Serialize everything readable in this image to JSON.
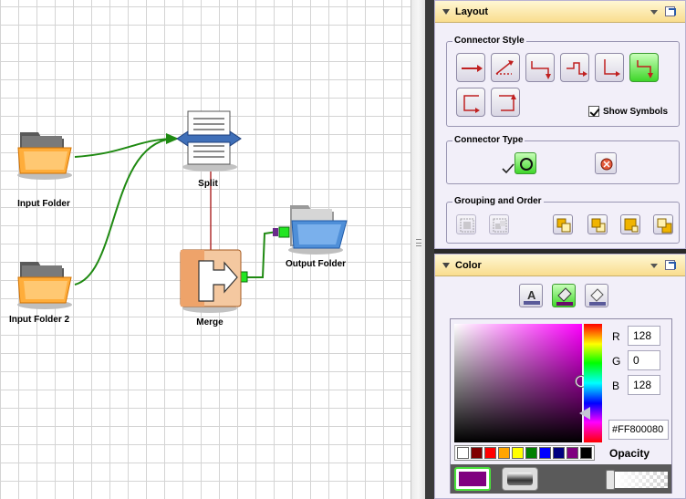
{
  "canvas": {
    "nodes": {
      "input_folder_1": {
        "label": "Input Folder"
      },
      "input_folder_2": {
        "label": "Input Folder 2"
      },
      "split": {
        "label": "Split"
      },
      "merge": {
        "label": "Merge"
      },
      "output_folder": {
        "label": "Output Folder"
      }
    }
  },
  "layout_panel": {
    "title": "Layout",
    "connector_style": {
      "title": "Connector Style",
      "buttons": [
        {
          "icon": "straight-connector-icon",
          "active": false
        },
        {
          "icon": "spline-connector-icon",
          "active": false
        },
        {
          "icon": "orthogonal-connector-icon",
          "active": false
        },
        {
          "icon": "ortho-step-connector-icon",
          "active": false
        },
        {
          "icon": "ortho-corner-connector-icon",
          "active": false
        },
        {
          "icon": "ortho-zigzag-connector-icon",
          "active": true
        },
        {
          "icon": "loop-left-connector-icon",
          "active": false
        },
        {
          "icon": "loop-right-connector-icon",
          "active": false
        }
      ],
      "show_symbols_label": "Show Symbols",
      "show_symbols_checked": true
    },
    "connector_type": {
      "title": "Connector Type",
      "options": [
        {
          "icon": "circle-connector-icon",
          "selected": true
        },
        {
          "icon": "cross-connector-icon",
          "selected": false
        }
      ]
    },
    "grouping_order": {
      "title": "Grouping and Order",
      "buttons": [
        "group-icon",
        "ungroup-icon",
        "bring-to-front-icon",
        "bring-forward-icon",
        "send-backward-icon",
        "send-to-back-icon"
      ]
    }
  },
  "color_panel": {
    "title": "Color",
    "mode_buttons": [
      "text-color-icon",
      "fill-color-icon",
      "stroke-color-icon"
    ],
    "r_label": "R",
    "r_value": "128",
    "g_label": "G",
    "g_value": "0",
    "b_label": "B",
    "b_value": "128",
    "hex_value": "#FF800080",
    "opacity_label": "Opacity",
    "current_color": "#800080",
    "swatches": [
      "#ffffff",
      "#800000",
      "#ff0000",
      "#ffa500",
      "#ffff00",
      "#008000",
      "#0000ff",
      "#000080",
      "#800080",
      "#000000"
    ]
  }
}
